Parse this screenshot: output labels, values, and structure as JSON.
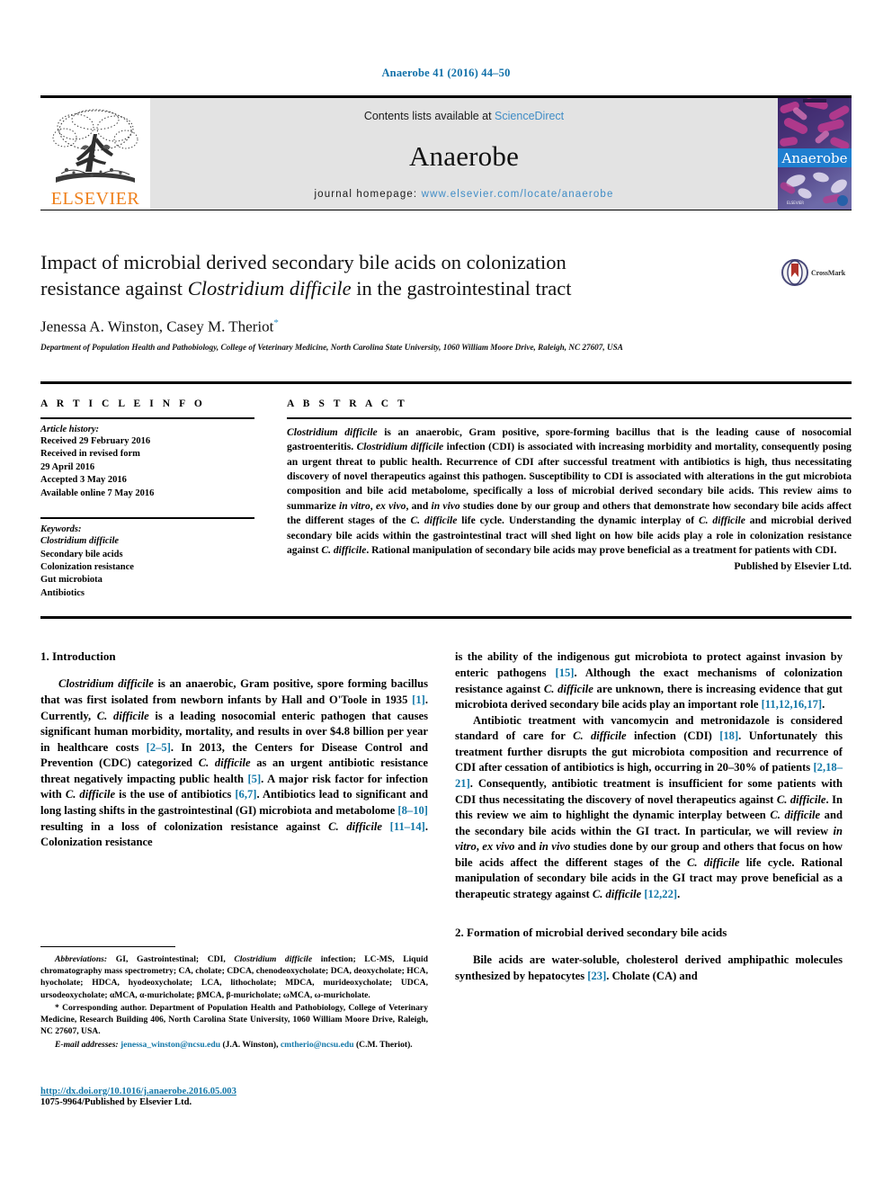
{
  "running_head": "Anaerobe 41 (2016) 44–50",
  "masthead": {
    "publisher_wordmark": "ELSEVIER",
    "contents_prefix": "Contents lists available at ",
    "contents_link": "ScienceDirect",
    "journal_name": "Anaerobe",
    "homepage_prefix": "journal homepage: ",
    "homepage_url": "www.elsevier.com/locate/anaerobe",
    "cover_title": "Anaerobe"
  },
  "article": {
    "title_line1": "Impact of microbial derived secondary bile acids on colonization",
    "title_line2_pre": "resistance against ",
    "title_line2_italic": "Clostridium difficile",
    "title_line2_post": " in the gastrointestinal tract",
    "authors": "Jenessa A. Winston, Casey M. Theriot",
    "author_star": "*",
    "affiliation": "Department of Population Health and Pathobiology, College of Veterinary Medicine, North Carolina State University, 1060 William Moore Drive, Raleigh, NC 27607, USA",
    "crossmark_label": "CrossMark"
  },
  "article_info": {
    "heading": "A R T I C L E  I N F O",
    "history_label": "Article history:",
    "history": [
      "Received 29 February 2016",
      "Received in revised form",
      "29 April 2016",
      "Accepted 3 May 2016",
      "Available online 7 May 2016"
    ],
    "keywords_label": "Keywords:",
    "keywords": [
      "Clostridium difficile",
      "Secondary bile acids",
      "Colonization resistance",
      "Gut microbiota",
      "Antibiotics"
    ]
  },
  "abstract": {
    "heading": "A B S T R A C T",
    "text": "Clostridium difficile is an anaerobic, Gram positive, spore-forming bacillus that is the leading cause of nosocomial gastroenteritis. Clostridium difficile infection (CDI) is associated with increasing morbidity and mortality, consequently posing an urgent threat to public health. Recurrence of CDI after successful treatment with antibiotics is high, thus necessitating discovery of novel therapeutics against this pathogen. Susceptibility to CDI is associated with alterations in the gut microbiota composition and bile acid metabolome, specifically a loss of microbial derived secondary bile acids. This review aims to summarize in vitro, ex vivo, and in vivo studies done by our group and others that demonstrate how secondary bile acids affect the different stages of the C. difficile life cycle. Understanding the dynamic interplay of C. difficile and microbial derived secondary bile acids within the gastrointestinal tract will shed light on how bile acids play a role in colonization resistance against C. difficile. Rational manipulation of secondary bile acids may prove beneficial as a treatment for patients with CDI.",
    "published_by": "Published by Elsevier Ltd."
  },
  "sections": {
    "intro_heading": "1. Introduction",
    "formation_heading": "2. Formation of microbial derived secondary bile acids"
  },
  "body": {
    "left_p1": "Clostridium difficile is an anaerobic, Gram positive, spore forming bacillus that was first isolated from newborn infants by Hall and O'Toole in 1935 [1]. Currently, C. difficile is a leading nosocomial enteric pathogen that causes significant human morbidity, mortality, and results in over $4.8 billion per year in healthcare costs [2–5]. In 2013, the Centers for Disease Control and Prevention (CDC) categorized C. difficile as an urgent antibiotic resistance threat negatively impacting public health [5]. A major risk factor for infection with C. difficile is the use of antibiotics [6,7]. Antibiotics lead to significant and long lasting shifts in the gastrointestinal (GI) microbiota and metabolome [8–10] resulting in a loss of colonization resistance against C. difficile [11–14]. Colonization resistance",
    "right_p1_cont": "is the ability of the indigenous gut microbiota to protect against invasion by enteric pathogens [15]. Although the exact mechanisms of colonization resistance against C. difficile are unknown, there is increasing evidence that gut microbiota derived secondary bile acids play an important role [11,12,16,17].",
    "right_p2": "Antibiotic treatment with vancomycin and metronidazole is considered standard of care for C. difficile infection (CDI) [18]. Unfortunately this treatment further disrupts the gut microbiota composition and recurrence of CDI after cessation of antibiotics is high, occurring in 20–30% of patients [2,18–21]. Consequently, antibiotic treatment is insufficient for some patients with CDI thus necessitating the discovery of novel therapeutics against C. difficile. In this review we aim to highlight the dynamic interplay between C. difficile and the secondary bile acids within the GI tract. In particular, we will review in vitro, ex vivo and in vivo studies done by our group and others that focus on how bile acids affect the different stages of the C. difficile life cycle. Rational manipulation of secondary bile acids in the GI tract may prove beneficial as a therapeutic strategy against C. difficile [12,22].",
    "right_p3": "Bile acids are water-soluble, cholesterol derived amphipathic molecules synthesized by hepatocytes [23]. Cholate (CA) and"
  },
  "footnotes": {
    "abbreviations_label": "Abbreviations:",
    "abbreviations_text": " GI, Gastrointestinal; CDI, Clostridium difficile infection; LC-MS, Liquid chromatography mass spectrometry; CA, cholate; CDCA, chenodeoxycholate; DCA, deoxycholate; HCA, hyocholate; HDCA, hyodeoxycholate; LCA, lithocholate; MDCA, murideoxycholate; UDCA, ursodeoxycholate; αMCA, α-muricholate; βMCA, β-muricholate; ωMCA, ω-muricholate.",
    "corresponding_marker": "*",
    "corresponding_text": " Corresponding author. Department of Population Health and Pathobiology, College of Veterinary Medicine, Research Building 406, North Carolina State University, 1060 William Moore Drive, Raleigh, NC 27607, USA.",
    "email_label": "E-mail addresses:",
    "email_1": "jenessa_winston@ncsu.edu",
    "email_1_owner": " (J.A. Winston), ",
    "email_2": "cmtherio@ncsu.edu",
    "email_2_owner": " (C.M. Theriot)."
  },
  "footer": {
    "doi": "http://dx.doi.org/10.1016/j.anaerobe.2016.05.003",
    "issn_line": "1075-9964/Published by Elsevier Ltd."
  },
  "colors": {
    "link_blue": "#1277a8",
    "science_direct_blue": "#3f8cc6",
    "elsevier_orange": "#ef7f1a",
    "masthead_gray": "#e3e3e3"
  }
}
